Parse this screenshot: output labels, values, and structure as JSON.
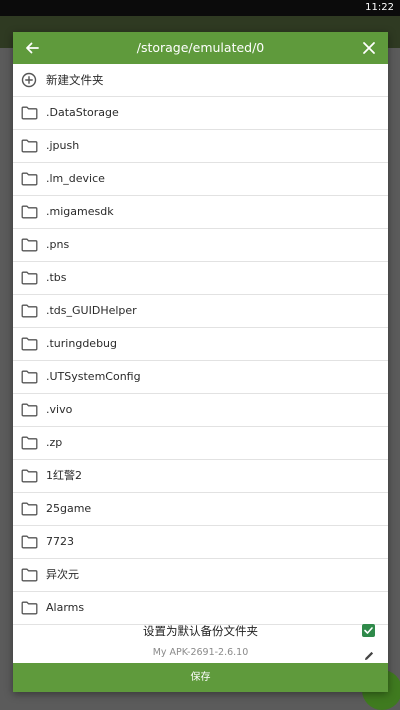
{
  "status_bar": {
    "time": "11:22"
  },
  "dialog": {
    "path": "/storage/emulated/0",
    "new_folder_label": "新建文件夹",
    "folders": [
      ".DataStorage",
      ".jpush",
      ".lm_device",
      ".migamesdk",
      ".pns",
      ".tbs",
      ".tds_GUIDHelper",
      ".turingdebug",
      ".UTSystemConfig",
      ".vivo",
      ".zp",
      "1红警2",
      "25game",
      "7723",
      "异次元",
      "Alarms"
    ],
    "set_default_label": "设置为默认备份文件夹",
    "set_default_checked": true,
    "backup_name": "My APK-2691-2.6.10",
    "save_label": "保存"
  },
  "colors": {
    "header": "#5f9a3c",
    "checkbox": "#2f8a4a",
    "background": "#5b5b5b"
  }
}
